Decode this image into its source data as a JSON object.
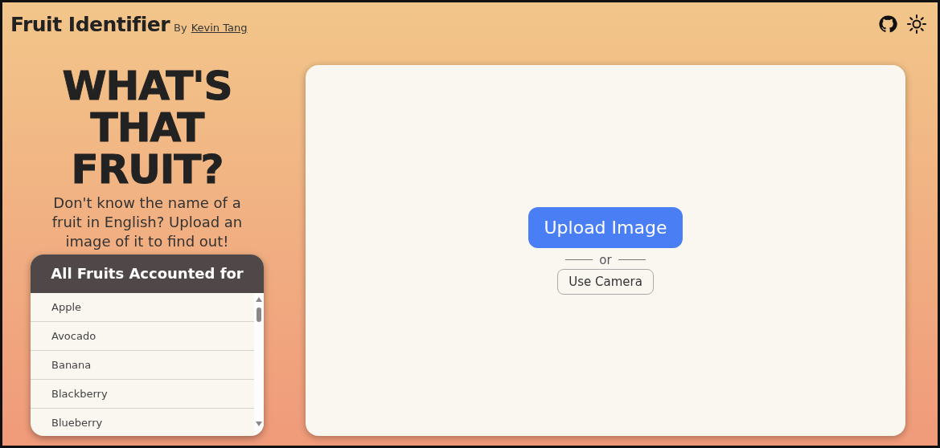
{
  "header": {
    "title": "Fruit Identifier",
    "byline": "By",
    "author": "Kevin Tang"
  },
  "hero": {
    "heading_lines": [
      "WHAT'S",
      "THAT",
      "FRUIT?"
    ],
    "description": "Don't know the name of a fruit in English? Upload an image of it to find out!"
  },
  "fruit_list": {
    "title": "All Fruits Accounted for",
    "items": [
      "Apple",
      "Avocado",
      "Banana",
      "Blackberry",
      "Blueberry"
    ]
  },
  "upload": {
    "upload_button": "Upload Image",
    "separator": "or",
    "camera_button": "Use Camera"
  }
}
